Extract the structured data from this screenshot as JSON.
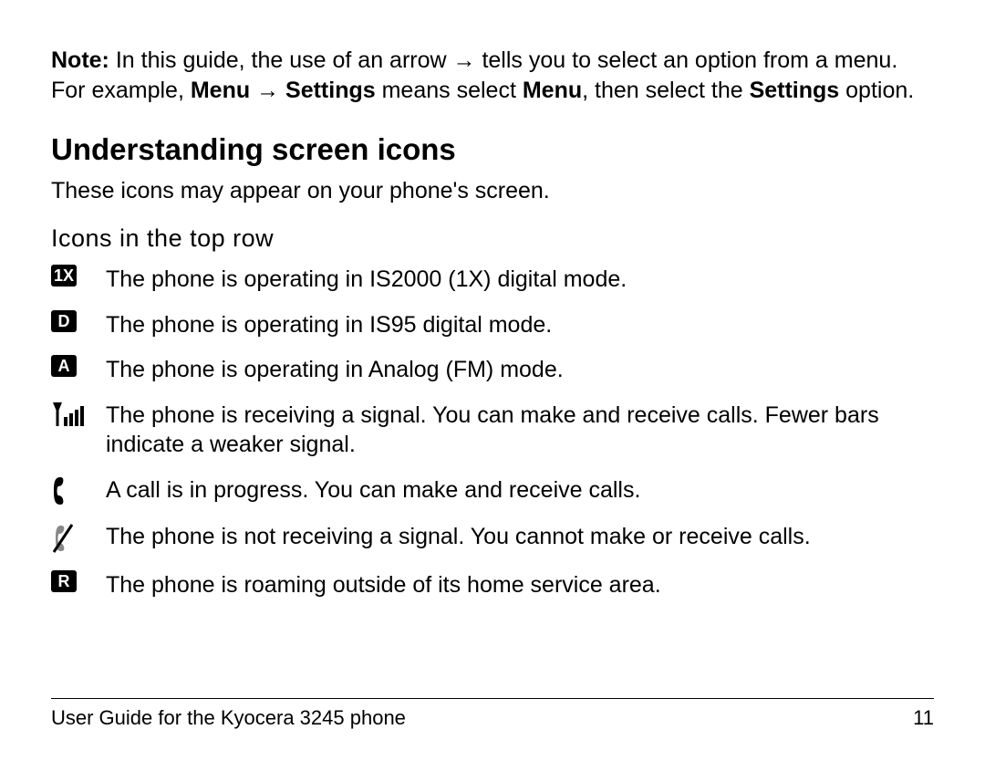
{
  "note": {
    "label": "Note:",
    "part1": " In this guide, the use of an arrow ",
    "arrow": "→",
    "part2": " tells you to select an option from a menu. For example, ",
    "menu": "Menu",
    "arrow2": " → ",
    "settings": "Settings",
    "part3": " means select ",
    "menu2": "Menu",
    "part4": ", then select the ",
    "settings2": "Settings",
    "part5": " option."
  },
  "heading": "Understanding screen icons",
  "intro": "These icons may appear on your phone's screen.",
  "subheading": "Icons in the top row",
  "icons": [
    {
      "badge": "1X",
      "desc": "The phone is operating in IS2000 (1X) digital mode."
    },
    {
      "badge": "D",
      "desc": "The phone is operating in IS95 digital mode."
    },
    {
      "badge": "A",
      "desc": "The phone is operating in Analog (FM) mode."
    },
    {
      "badge": "",
      "desc": "The phone is receiving a signal. You can make and receive calls. Fewer bars indicate a weaker signal."
    },
    {
      "badge": "",
      "desc": "A call is in progress. You can make and receive calls."
    },
    {
      "badge": "",
      "desc": "The phone is not receiving a signal. You cannot make or receive calls."
    },
    {
      "badge": "R",
      "desc": "The phone is roaming outside of its home service area."
    }
  ],
  "footer": {
    "left": "User Guide for the Kyocera 3245 phone",
    "right": "11"
  }
}
